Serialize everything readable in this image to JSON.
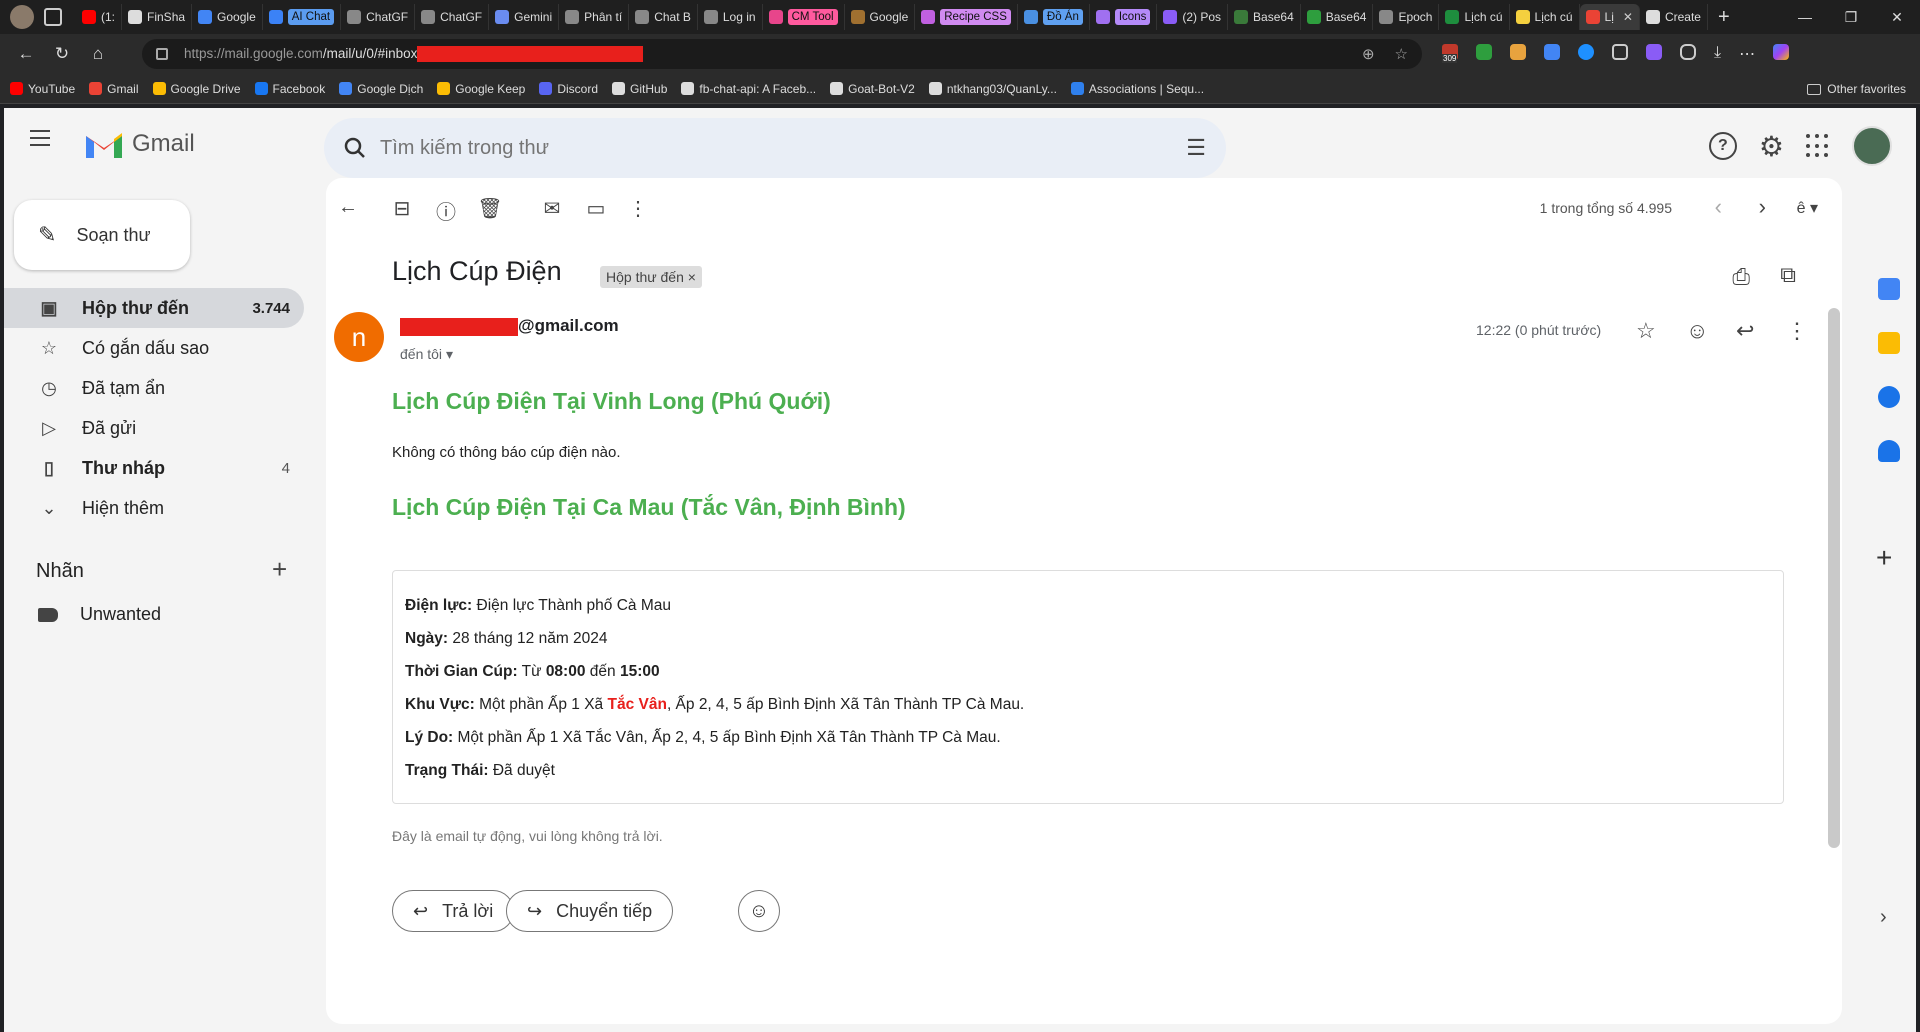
{
  "browser": {
    "tabs": [
      {
        "label": "(1:",
        "color": "#ff0000"
      },
      {
        "label": "FinSha",
        "color": "#dddddd"
      },
      {
        "label": "Google",
        "color": "#4285f4"
      },
      {
        "label": "AI Chat",
        "color": "#3b82f6",
        "pill": true,
        "pill_color": "#5b9cf0"
      },
      {
        "label": "ChatGF",
        "color": "#888888"
      },
      {
        "label": "ChatGF",
        "color": "#888888"
      },
      {
        "label": "Gemini",
        "color": "#6a8cf0"
      },
      {
        "label": "Phân tí",
        "color": "#888888"
      },
      {
        "label": "Chat B",
        "color": "#888888"
      },
      {
        "label": "Log in",
        "color": "#888888"
      },
      {
        "label": "CM Tool",
        "color": "#e8458b",
        "pill": true,
        "pill_color": "#ff5a9e"
      },
      {
        "label": "Google",
        "color": "#a07030"
      },
      {
        "label": "Recipe CSS",
        "color": "#c060e0",
        "pill": true,
        "pill_color": "#d08af0"
      },
      {
        "label": "Đồ Án",
        "color": "#4a90e2",
        "pill": true,
        "pill_color": "#5fa0f0"
      },
      {
        "label": "Icons",
        "color": "#a070f0",
        "pill": true,
        "pill_color": "#b48af8"
      },
      {
        "label": "(2) Pos",
        "color": "#8a5cf6"
      },
      {
        "label": "Base64",
        "color": "#3a7a3a"
      },
      {
        "label": "Base64",
        "color": "#2e9e3e"
      },
      {
        "label": "Epoch",
        "color": "#888888"
      },
      {
        "label": "Lịch cú",
        "color": "#1e8e3e"
      },
      {
        "label": "Lịch cú",
        "color": "#f4d03f"
      },
      {
        "label": "Lị",
        "color": "#ea4335",
        "active": true
      },
      {
        "label": "Create",
        "color": "#dddddd"
      }
    ],
    "window_controls": [
      "—",
      "❐",
      "✕"
    ],
    "url_prefix": "https://mail.google.com",
    "url_rest": "/mail/u/0/#inbox",
    "bookmarks": [
      {
        "label": "YouTube",
        "color": "#ff0000"
      },
      {
        "label": "Gmail",
        "color": "#ea4335"
      },
      {
        "label": "Google Drive",
        "color": "#fbbc04"
      },
      {
        "label": "Facebook",
        "color": "#1877f2"
      },
      {
        "label": "Google Dịch",
        "color": "#4285f4"
      },
      {
        "label": "Google Keep",
        "color": "#fbbc04"
      },
      {
        "label": "Discord",
        "color": "#5865f2"
      },
      {
        "label": "GitHub",
        "color": "#dddddd"
      },
      {
        "label": "fb-chat-api: A Faceb...",
        "color": "#dddddd"
      },
      {
        "label": "Goat-Bot-V2",
        "color": "#dddddd"
      },
      {
        "label": "ntkhang03/QuanLy...",
        "color": "#dddddd"
      },
      {
        "label": "Associations | Sequ...",
        "color": "#2f80ed"
      }
    ],
    "other_favorites": "Other favorites",
    "ext_badge": "309"
  },
  "gmail": {
    "logo_text": "Gmail",
    "search_placeholder": "Tìm kiếm trong thư",
    "compose_label": "Soạn thư",
    "nav": [
      {
        "label": "Hộp thư đến",
        "count": "3.744",
        "icon": "inbox-icon",
        "active": true
      },
      {
        "label": "Có gắn dấu sao",
        "count": "",
        "icon": "star-icon"
      },
      {
        "label": "Đã tạm ẩn",
        "count": "",
        "icon": "clock-icon"
      },
      {
        "label": "Đã gửi",
        "count": "",
        "icon": "send-icon"
      },
      {
        "label": "Thư nháp",
        "count": "4",
        "icon": "draft-icon",
        "bold": true
      },
      {
        "label": "Hiện thêm",
        "count": "",
        "icon": "chevron-down-icon"
      }
    ],
    "labels_heading": "Nhãn",
    "labels": [
      {
        "label": "Unwanted"
      }
    ],
    "pager_text": "1 trong tổng số 4.995",
    "subject": "Lịch Cúp Điện",
    "subject_badge": "Hộp thư đến",
    "sender_initial": "n",
    "sender_email_suffix": "@gmail.com",
    "to_me": "đến tôi",
    "time": "12:22 (0 phút trước)",
    "section1_heading": "Lịch Cúp Điện Tại Vinh Long (Phú Quới)",
    "section1_text": "Không có thông báo cúp điện nào.",
    "section2_heading": "Lịch Cúp Điện Tại Ca Mau (Tắc Vân, Định Bình)",
    "info": {
      "dien_luc_label": "Điện lực:",
      "dien_luc_value": " Điện lực Thành phố Cà Mau",
      "ngay_label": "Ngày:",
      "ngay_value": " 28 tháng 12 năm 2024",
      "thoi_gian_label": "Thời Gian Cúp:",
      "thoi_gian_tu": " Từ ",
      "thoi_gian_start": "08:00",
      "thoi_gian_den": " đến ",
      "thoi_gian_end": "15:00",
      "khu_vuc_label": "Khu Vực:",
      "khu_vuc_pre": " Một phần Ấp 1 Xã ",
      "khu_vuc_highlight": "Tắc Vân",
      "khu_vuc_post": ", Ấp 2, 4, 5 ấp Bình Định Xã Tân Thành TP Cà Mau.",
      "ly_do_label": "Lý Do:",
      "ly_do_value": " Một phần Ấp 1 Xã Tắc Vân, Ấp 2, 4, 5 ấp Bình Định Xã Tân Thành TP Cà Mau.",
      "trang_thai_label": "Trạng Thái:",
      "trang_thai_value": " Đã duyệt"
    },
    "footer_note": "Đây là email tự động, vui lòng không trả lời.",
    "reply_label": "Trả lời",
    "forward_label": "Chuyển tiếp"
  }
}
